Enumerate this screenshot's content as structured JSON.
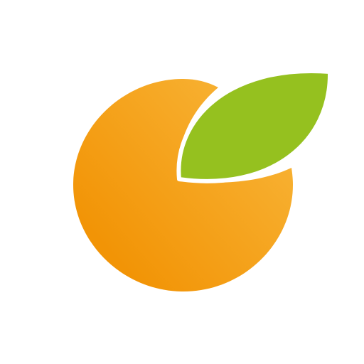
{
  "logo": {
    "icon": "orange-fruit-with-leaf-icon",
    "colors": {
      "background": "#ffffff",
      "fruit_light": "#F8B335",
      "fruit_dark": "#F29406",
      "leaf": "#95C11F",
      "outline": "#ffffff"
    }
  }
}
